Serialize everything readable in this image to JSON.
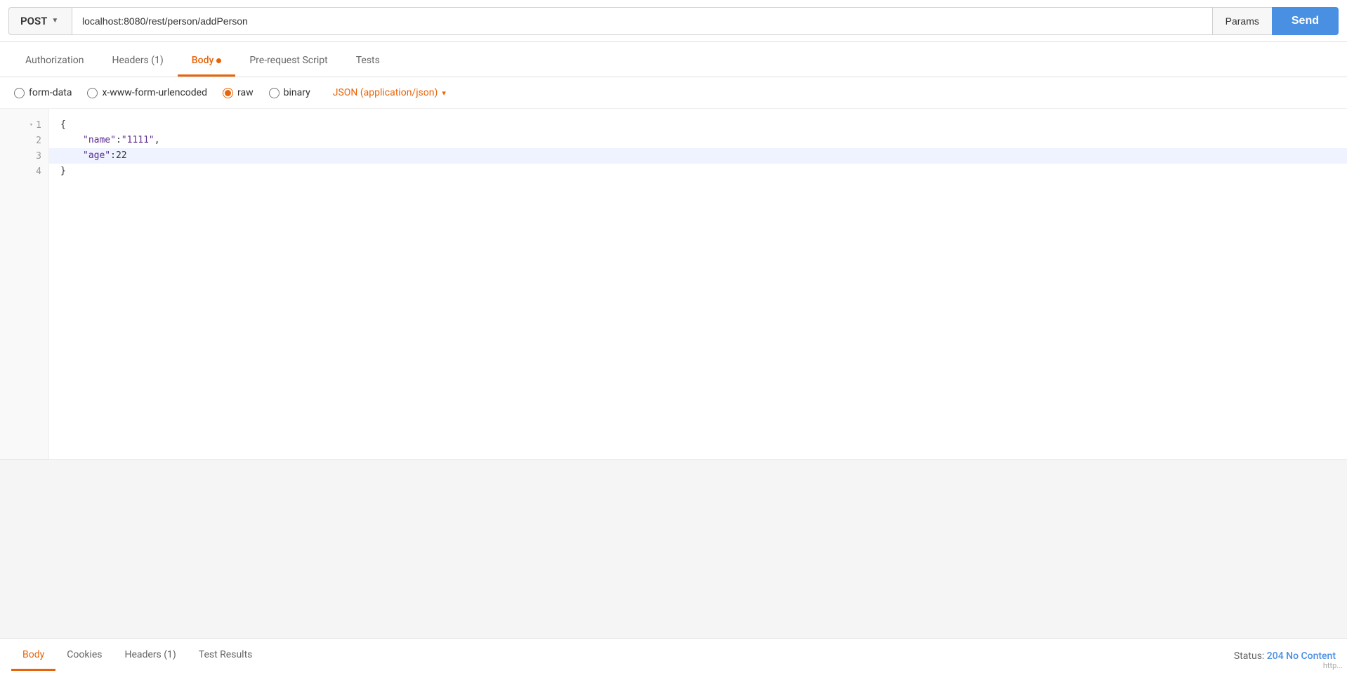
{
  "url_bar": {
    "method": "POST",
    "method_chevron": "▼",
    "url": "localhost:8080/rest/person/addPerson",
    "params_label": "Params",
    "send_label": "Send"
  },
  "tabs": [
    {
      "id": "authorization",
      "label": "Authorization",
      "active": false,
      "has_dot": false
    },
    {
      "id": "headers",
      "label": "Headers (1)",
      "active": false,
      "has_dot": false
    },
    {
      "id": "body",
      "label": "Body",
      "active": true,
      "has_dot": true
    },
    {
      "id": "pre-request-script",
      "label": "Pre-request Script",
      "active": false,
      "has_dot": false
    },
    {
      "id": "tests",
      "label": "Tests",
      "active": false,
      "has_dot": false
    }
  ],
  "body_types": [
    {
      "id": "form-data",
      "label": "form-data",
      "checked": false
    },
    {
      "id": "urlencoded",
      "label": "x-www-form-urlencoded",
      "checked": false
    },
    {
      "id": "raw",
      "label": "raw",
      "checked": true
    },
    {
      "id": "binary",
      "label": "binary",
      "checked": false
    }
  ],
  "json_type": {
    "label": "JSON (application/json)",
    "arrow": "▾"
  },
  "code_lines": [
    {
      "number": "1",
      "has_collapse": true,
      "content": "{",
      "highlighted": false
    },
    {
      "number": "2",
      "has_collapse": false,
      "content": "    \"name\":\"1111\",",
      "highlighted": false
    },
    {
      "number": "3",
      "has_collapse": false,
      "content": "    \"age\":22",
      "highlighted": true
    },
    {
      "number": "4",
      "has_collapse": false,
      "content": "}",
      "highlighted": false
    }
  ],
  "response_tabs": [
    {
      "id": "body",
      "label": "Body",
      "active": true
    },
    {
      "id": "cookies",
      "label": "Cookies",
      "active": false
    },
    {
      "id": "headers",
      "label": "Headers (1)",
      "active": false
    },
    {
      "id": "test-results",
      "label": "Test Results",
      "active": false
    }
  ],
  "status": {
    "label": "Status:",
    "code": "204 No Content"
  },
  "watermark": "http..."
}
